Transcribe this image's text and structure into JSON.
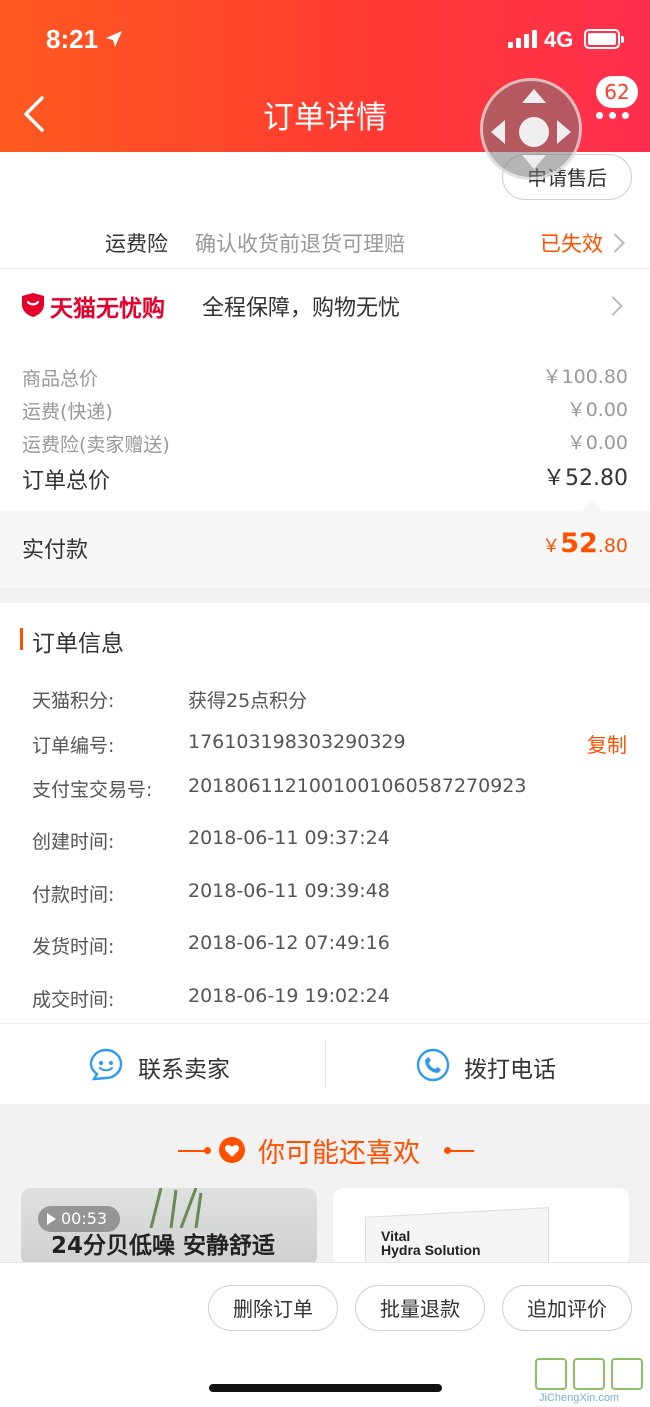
{
  "status_bar": {
    "time": "8:21",
    "network": "4G"
  },
  "header": {
    "title": "订单详情",
    "badge_count": "62",
    "apply_aftersale": "申请售后"
  },
  "freight_insurance": {
    "label": "运费险",
    "desc": "确认收货前退货可理赔",
    "status": "已失效"
  },
  "tmall": {
    "logo_text": "天猫无忧购",
    "slogan": "全程保障，购物无忧"
  },
  "price": {
    "rows": [
      {
        "label": "商品总价",
        "value": "￥100.80"
      },
      {
        "label": "运费(快递)",
        "value": "￥0.00"
      },
      {
        "label": "运费险(卖家赠送)",
        "value": "￥0.00"
      }
    ],
    "total_label": "订单总价",
    "total_value": "￥52.80",
    "paid_label": "实付款",
    "paid_symbol": "￥",
    "paid_int": "52",
    "paid_dec": ".80"
  },
  "order_info": {
    "title": "订单信息",
    "copy_label": "复制",
    "items": [
      {
        "label": "天猫积分:",
        "value": "获得25点积分"
      },
      {
        "label": "订单编号:",
        "value": "176103198303290329"
      },
      {
        "label": "支付宝交易号:",
        "value": "2018061121001001060587270923"
      },
      {
        "label": "创建时间:",
        "value": "2018-06-11 09:37:24"
      },
      {
        "label": "付款时间:",
        "value": "2018-06-11 09:39:48"
      },
      {
        "label": "发货时间:",
        "value": "2018-06-12 07:49:16"
      },
      {
        "label": "成交时间:",
        "value": "2018-06-19 19:02:24"
      }
    ]
  },
  "contact": {
    "seller": "联系卖家",
    "phone": "拨打电话"
  },
  "recommend": {
    "title": "你可能还喜欢",
    "card1_duration": "00:53",
    "card1_caption": "24分贝低噪 安静舒适",
    "card2_brand_line1": "Vital",
    "card2_brand_line2": "Hydra Solution"
  },
  "actions": {
    "delete": "删除订单",
    "batch_refund": "批量退款",
    "add_review": "追加评价"
  },
  "watermark": {
    "text": "JiChengXin.com"
  },
  "colors": {
    "accent": "#ff5000",
    "header_start": "#ff5a1f",
    "header_end": "#ff2e4e"
  }
}
